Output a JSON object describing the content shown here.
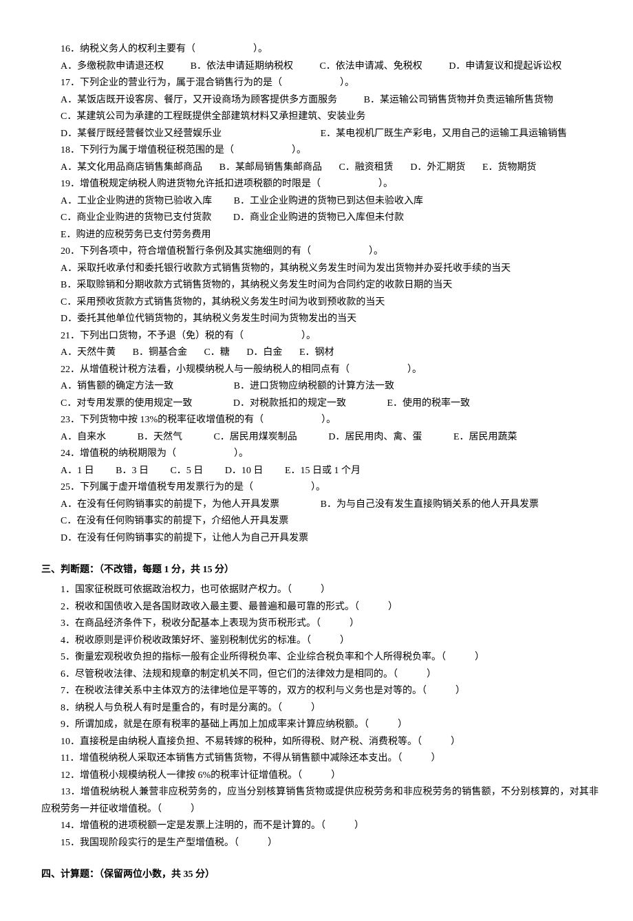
{
  "mc": {
    "q16": {
      "stem": "16．纳税义务人的权利主要有（　　　　　　）。",
      "A": "A．多缴税款申请退还权",
      "B": "B．依法申请延期纳税权",
      "C": "C．依法申请减、免税权",
      "D": "D．申请复议和提起诉讼权"
    },
    "q17": {
      "stem": "17．下列企业的营业行为，属于混合销售行为的是（　　　　　　）。",
      "A": "A．某饭店既开设客房、餐厅，又开设商场为顾客提供多方面服务",
      "B": "B．某运输公司销售货物并负责运输所售货物",
      "C": "C．某建筑公司为承建的工程既提供全部建筑材料又承担建筑、安装业务",
      "D": "D．某餐厅既经营餐饮业又经营娱乐业",
      "E": "E．某电视机厂既生产彩电，又用自己的运输工具运输销售"
    },
    "q18": {
      "stem": "18．下列行为属于增值税征税范围的是（　　　　　　）。",
      "A": "A．某文化用品商店销售集邮商品",
      "B": "B．某邮局销售集邮商品",
      "C": "C．融资租赁",
      "D": "D．外汇期货",
      "E": "E．货物期货"
    },
    "q19": {
      "stem": "19．增值税规定纳税人购进货物允许抵扣进项税额的时限是（　　　　　　）。",
      "A": "A．工业企业购进的货物已验收入库",
      "B": "B．工业企业购进的货物已到达但未验收入库",
      "C": "C．商业企业购进的货物已支付货款",
      "D": "D．商业企业购进的货物已入库但未付款",
      "E": "E．购进的应税劳务已支付劳务费用"
    },
    "q20": {
      "stem": "20．下列各项中，符合增值税暂行条例及其实施细则的有（　　　　　　）。",
      "A": "A．采取托收承付和委托银行收款方式销售货物的，其纳税义务发生时间为发出货物并办妥托收手续的当天",
      "B": "B．采取赊销和分期收款方式销售货物的，其纳税义务发生时间为合同约定的收款日期的当天",
      "C": "C．采用预收货款方式销售货物的，其纳税义务发生时间为收到预收款的当天",
      "D": "D．委托其他单位代销货物的，其纳税义务发生时间为货物发出的当天"
    },
    "q21": {
      "stem": "21．下列出口货物，不予退（免）税的有（　　　　　　）。",
      "A": "A．天然牛黄",
      "B": "B．铜基合金",
      "C": "C．糖",
      "D": "D．白金",
      "E": "E．钢材"
    },
    "q22": {
      "stem": "22．从增值税计税方法看，小规模纳税人与一般纳税人的相同点有（　　　　　　）。",
      "A": "A．销售额的确定方法一致",
      "B": "B．进口货物应纳税额的计算方法一致",
      "C": "C．对专用发票的使用规定一致",
      "D": "D．对税款抵扣的规定一致",
      "E": "E．使用的税率一致"
    },
    "q23": {
      "stem": "23．下列货物中按 13%的税率征收增值税的有（　　　　　　）。",
      "A": "A．自来水",
      "B": "B．天然气",
      "C": "C．居民用煤炭制品",
      "D": "D．居民用肉、禽、蛋",
      "E": "E．居民用蔬菜"
    },
    "q24": {
      "stem": "24．增值税的纳税期限为（　　　　　　）。",
      "A": "A．1 日",
      "B": "B．3 日",
      "C": "C．5 日",
      "D": "D．10 日",
      "E": "E．15 日或 1 个月"
    },
    "q25": {
      "stem": "25．下列属于虚开增值税专用发票行为的是（　　　　　　）。",
      "A": "A．在没有任何购销事实的前提下，为他人开具发票",
      "B": "B．为与自己没有发生直接购销关系的他人开具发票",
      "C": "C．在没有任何购销事实的前提下，介绍他人开具发票",
      "D": "D．在没有任何购销事实的前提下，让他人为自己开具发票"
    }
  },
  "section3_title": "三、判断题：（不改错，每题 1 分，共 15 分）",
  "tf": {
    "t1": "1．国家征税既可依据政治权力，也可依据财产权力。（　　　）",
    "t2": "2．税收和国债收入是各国财政收入最主要、最普遍和最可靠的形式。（　　　）",
    "t3": "3．在商品经济条件下，税收分配基本上表现为货币税形式。（　　　）",
    "t4": "4．税收原则是评价税收政策好坏、鉴别税制优劣的标准。（　　　）",
    "t5": "5．衡量宏观税收负担的指标一般有企业所得税负率、企业综合税负率和个人所得税负率。（　　　）",
    "t6": "6．尽管税收法律、法规和规章的制定机关不同，但它们的法律效力是相同的。（　　　）",
    "t7": "7．在税收法律关系中主体双方的法律地位是平等的，双方的权利与义务也是对等的。（　　　）",
    "t8": "8．纳税人与负税人有时是重合的，有时是分离的。（　　　）",
    "t9": "9．所谓加成，就是在原有税率的基础上再加上加成率来计算应纳税额。（　　　）",
    "t10": "10．直接税是由纳税人直接负担、不易转嫁的税种，如所得税、财产税、消费税等。（　　　）",
    "t11": "11．增值税纳税人采取还本销售方式销售货物，不得从销售额中减除还本支出。（　　　）",
    "t12": "12．增值税小规模纳税人一律按 6%的税率计征增值税。（　　　）",
    "t13": "　　13．增值税纳税人兼营非应税劳务的，应当分别核算销售货物或提供应税劳务和非应税劳务的销售额，不分别核算的，对其非应税劳务一并征收增值税。（　　　）",
    "t14": "14．增值税的进项税额一定是发票上注明的，而不是计算的。（　　　）",
    "t15": "15．我国现阶段实行的是生产型增值税。（　　　）"
  },
  "section4_title": "四、计算题：（保留两位小数，共 35 分）"
}
